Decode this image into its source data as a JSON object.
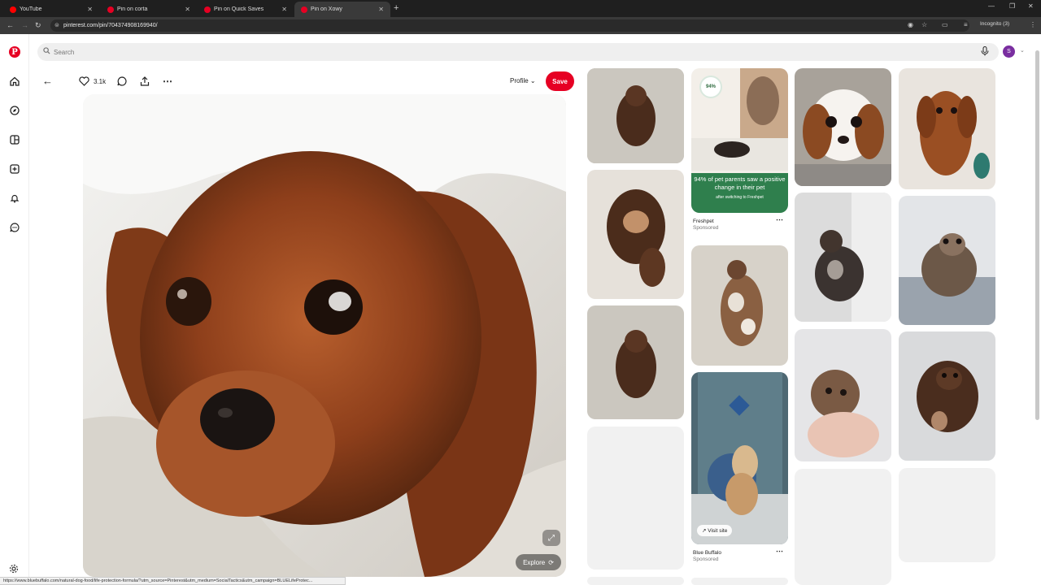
{
  "browser": {
    "tabs": [
      {
        "title": "YouTube",
        "color": "#ff0000"
      },
      {
        "title": "Pin on corta",
        "color": "#e60023"
      },
      {
        "title": "Pin on Quick Saves",
        "color": "#e60023"
      },
      {
        "title": "Pin on Xowy",
        "color": "#e60023"
      }
    ],
    "url": "pinterest.com/pin/704374908169940/",
    "incognito_label": "Incognito (3)"
  },
  "search": {
    "placeholder": "Search"
  },
  "avatar_initial": "S",
  "pin": {
    "likes": "3.1k",
    "profile_label": "Profile",
    "save_label": "Save",
    "explore_label": "Explore"
  },
  "feed": {
    "ad1": {
      "badge": "94%",
      "headline": "94% of pet parents saw a positive change in their pet",
      "subline": "after switching to Freshpet",
      "name": "Freshpet",
      "tag": "Sponsored"
    },
    "ad2": {
      "visit_label": "Visit site",
      "name": "Blue Buffalo",
      "tag": "Sponsored"
    }
  },
  "status_url": "https://www.bluebuffalo.com/natural-dog-food/life-protection-formula/?utm_source=Pinterest&utm_medium=SocialTactics&utm_campaign=BLUELifeProtec...",
  "colors": {
    "brand": "#e60023",
    "avatar": "#7a2ea0"
  }
}
